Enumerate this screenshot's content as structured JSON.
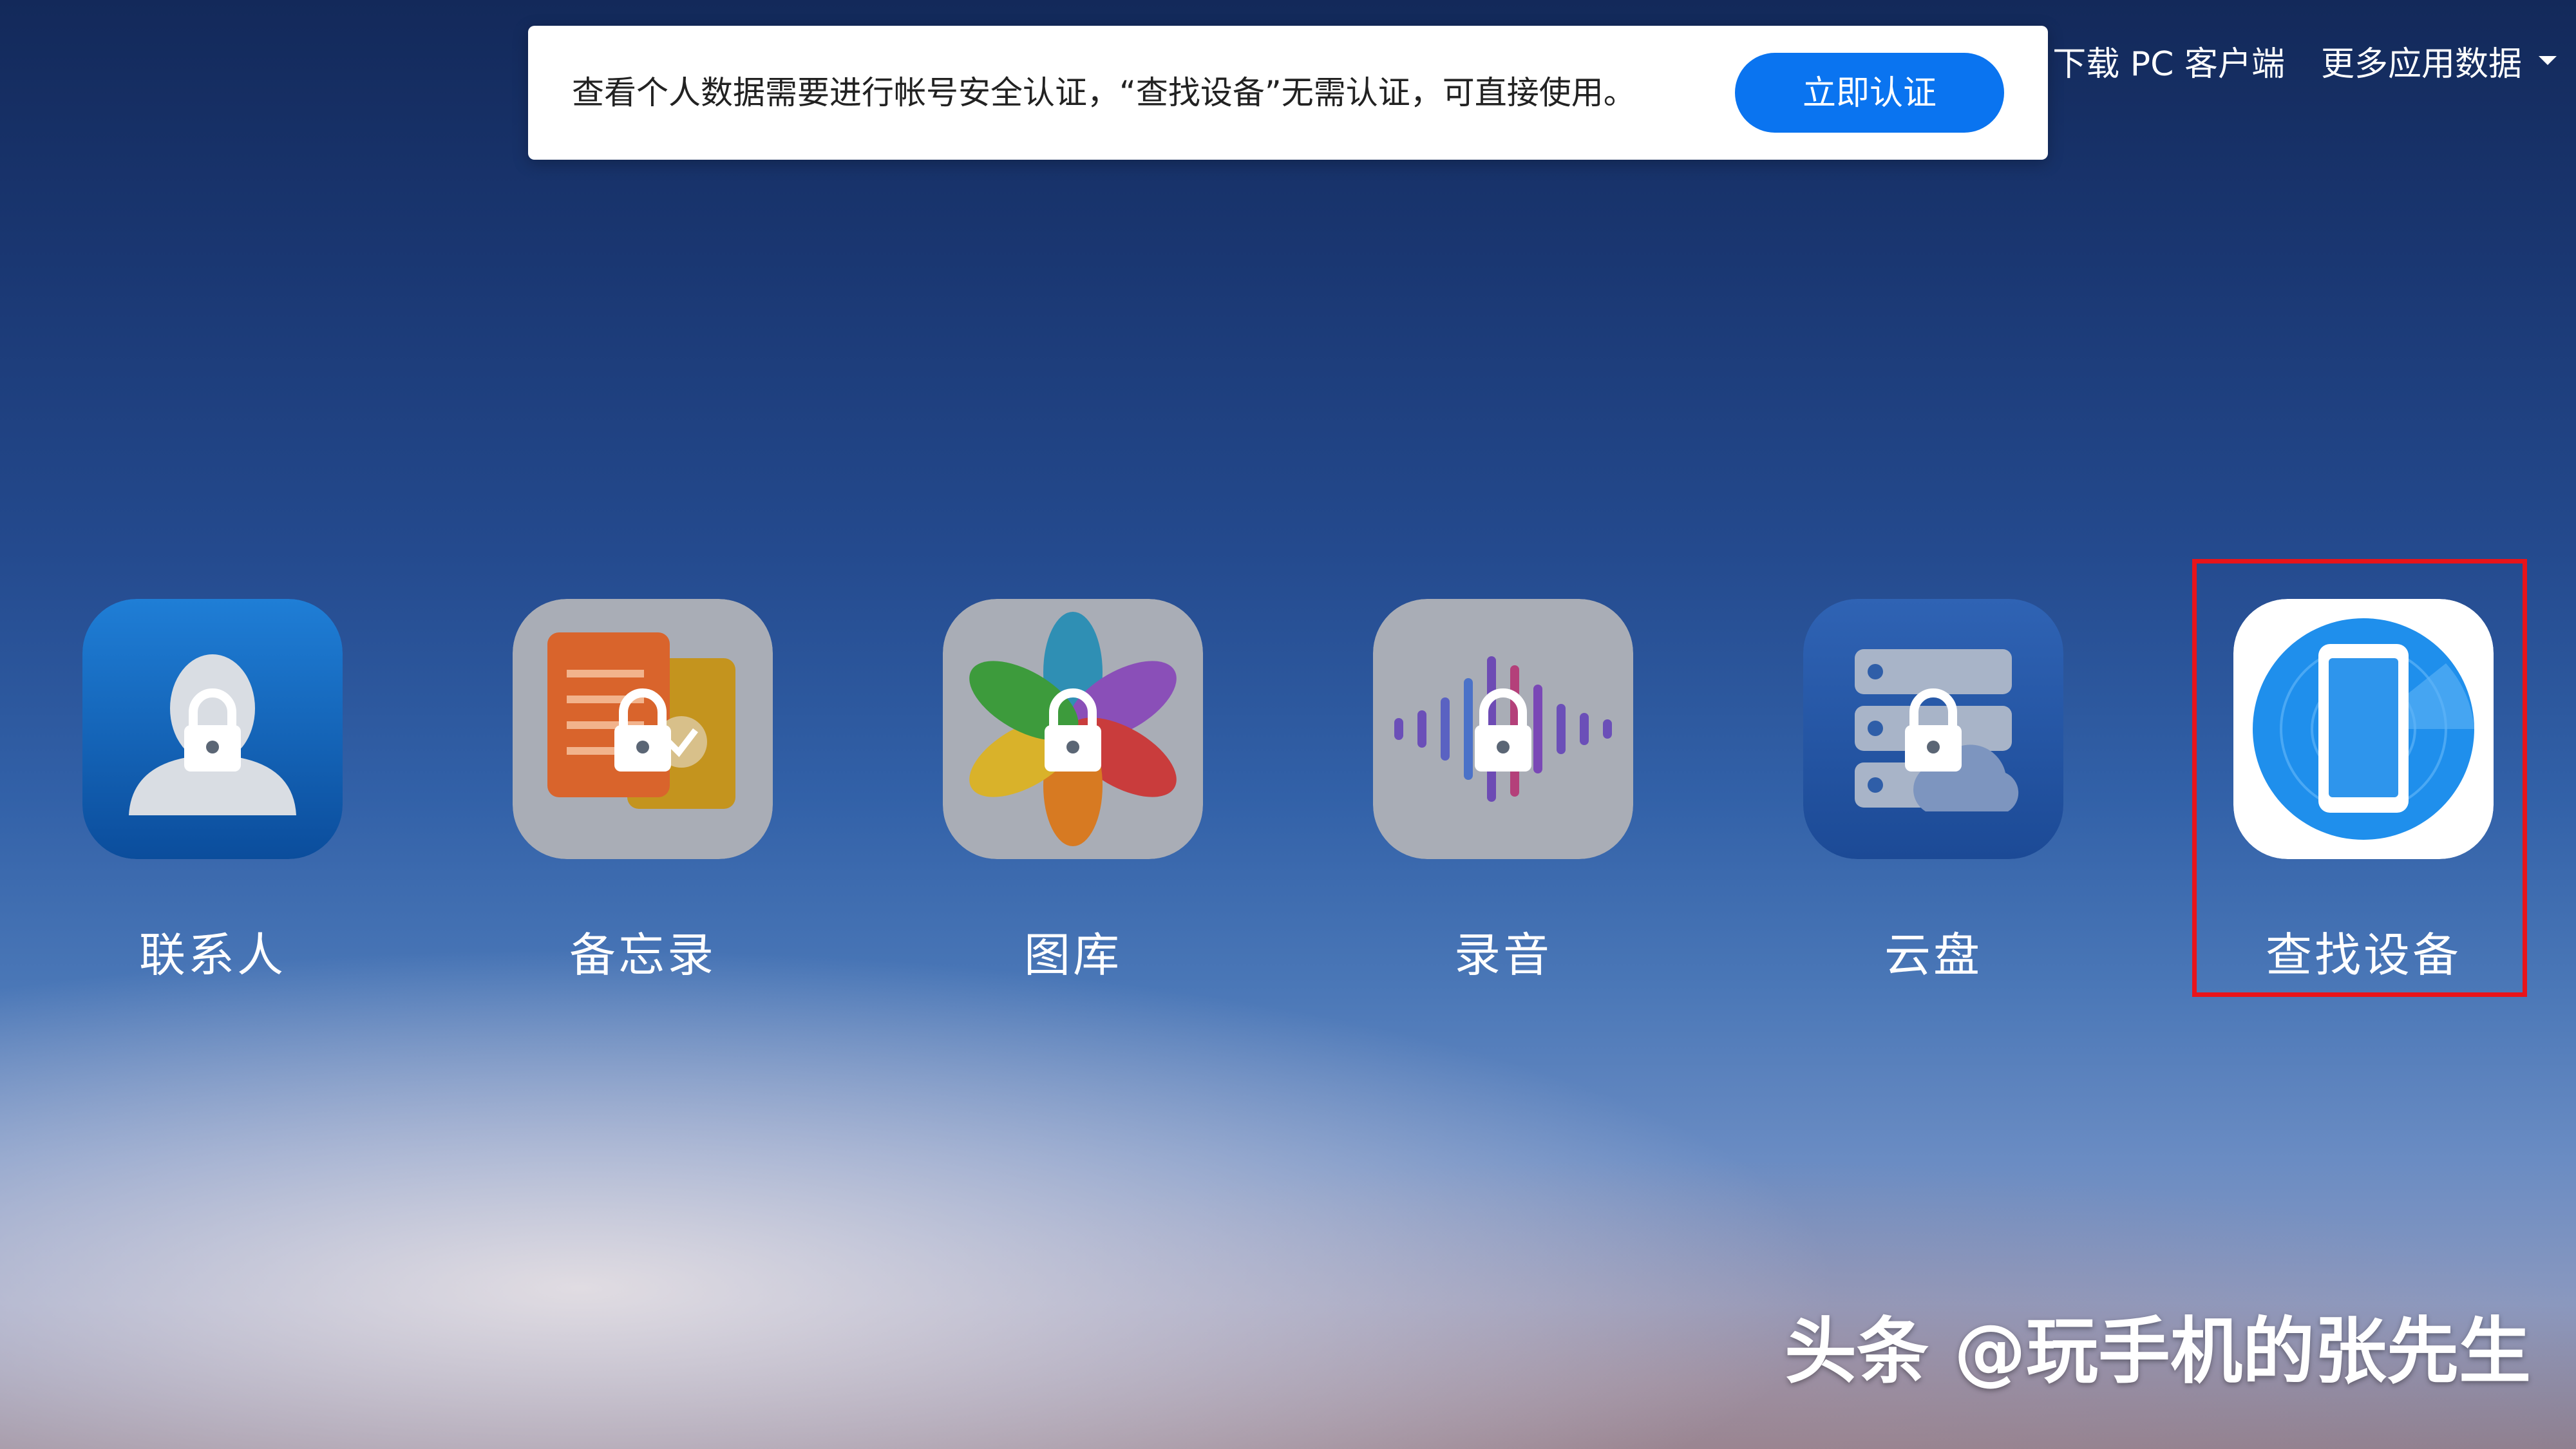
{
  "banner": {
    "message": "查看个人数据需要进行帐号安全认证，“查找设备”无需认证，可直接使用。",
    "verify_label": "立即认证"
  },
  "topnav": {
    "download_label": "下载 PC 客户端",
    "more_data_label": "更多应用数据"
  },
  "apps": [
    {
      "label": "联系人",
      "icon": "contacts-icon",
      "locked": true
    },
    {
      "label": "备忘录",
      "icon": "notes-icon",
      "locked": true
    },
    {
      "label": "图库",
      "icon": "gallery-icon",
      "locked": true
    },
    {
      "label": "录音",
      "icon": "recorder-icon",
      "locked": true
    },
    {
      "label": "云盘",
      "icon": "cloud-drive-icon",
      "locked": true
    },
    {
      "label": "查找设备",
      "icon": "find-device-icon",
      "locked": false
    }
  ],
  "colors": {
    "accent": "#0a74f0",
    "highlight": "#e8141a",
    "locked_tile": "#a9adb6"
  },
  "watermark": "头条 @玩手机的张先生"
}
